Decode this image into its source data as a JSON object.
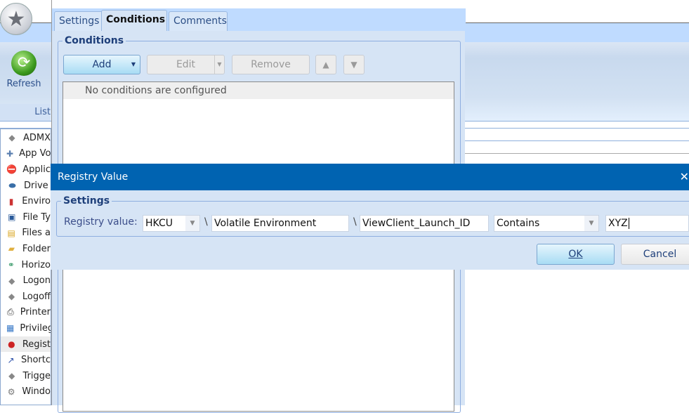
{
  "app": {
    "ribbon": {
      "refresh_label": "Refresh",
      "group_label": "List"
    },
    "list_items": [
      {
        "label": "ADMX",
        "icon": "diamond-icon",
        "glyph": "◆",
        "color": "#888"
      },
      {
        "label": "App Vo",
        "icon": "puzzle-icon",
        "glyph": "✚",
        "color": "#5a7fb0"
      },
      {
        "label": "Applic",
        "icon": "application-blocked-icon",
        "glyph": "⛔",
        "color": "#d22"
      },
      {
        "label": "Drive",
        "icon": "drive-icon",
        "glyph": "⬬",
        "color": "#3a6fa8"
      },
      {
        "label": "Enviro",
        "icon": "environment-icon",
        "glyph": "▮",
        "color": "#c33"
      },
      {
        "label": "File Ty",
        "icon": "file-type-icon",
        "glyph": "▣",
        "color": "#2a5a9a"
      },
      {
        "label": "Files a",
        "icon": "files-icon",
        "glyph": "▤",
        "color": "#d9a520"
      },
      {
        "label": "Folder",
        "icon": "folder-icon",
        "glyph": "▰",
        "color": "#e0b040"
      },
      {
        "label": "Horizo",
        "icon": "horizon-icon",
        "glyph": "⚭",
        "color": "#3a9a6a"
      },
      {
        "label": "Logon",
        "icon": "diamond-icon",
        "glyph": "◆",
        "color": "#888"
      },
      {
        "label": "Logoff",
        "icon": "diamond-icon",
        "glyph": "◆",
        "color": "#888"
      },
      {
        "label": "Printer",
        "icon": "printer-icon",
        "glyph": "⎙",
        "color": "#333"
      },
      {
        "label": "Privileg",
        "icon": "privilege-icon",
        "glyph": "▦",
        "color": "#3a7ac8"
      },
      {
        "label": "Regist",
        "icon": "registry-icon",
        "glyph": "●",
        "color": "#c22"
      },
      {
        "label": "Shortc",
        "icon": "shortcut-icon",
        "glyph": "↗",
        "color": "#2a4ea8"
      },
      {
        "label": "Trigge",
        "icon": "diamond-icon",
        "glyph": "◆",
        "color": "#888"
      },
      {
        "label": "Windo",
        "icon": "gear-icon",
        "glyph": "⚙",
        "color": "#777"
      }
    ],
    "selected_item": "Regist"
  },
  "conditions_dialog": {
    "tabs": [
      {
        "label": "Settings"
      },
      {
        "label": "Conditions"
      },
      {
        "label": "Comments"
      }
    ],
    "active_tab": "Conditions",
    "group_title": "Conditions",
    "buttons": {
      "add": "Add",
      "edit": "Edit",
      "remove": "Remove",
      "up": "▲",
      "down": "▼"
    },
    "empty_text": "No conditions are configured"
  },
  "registry_dialog": {
    "title": "Registry Value",
    "close": "✕",
    "group_title": "Settings",
    "label": "Registry value:",
    "hive": "HKCU",
    "separator": "\\",
    "key": "Volatile Environment",
    "value_name": "ViewClient_Launch_ID",
    "operator": "Contains",
    "match_value": "XYZ",
    "ok": "OK",
    "cancel": "Cancel"
  },
  "colors": {
    "titlebar": "#0063b1",
    "panel": "#d6e4f5",
    "ribbon": "#bfdbff"
  }
}
